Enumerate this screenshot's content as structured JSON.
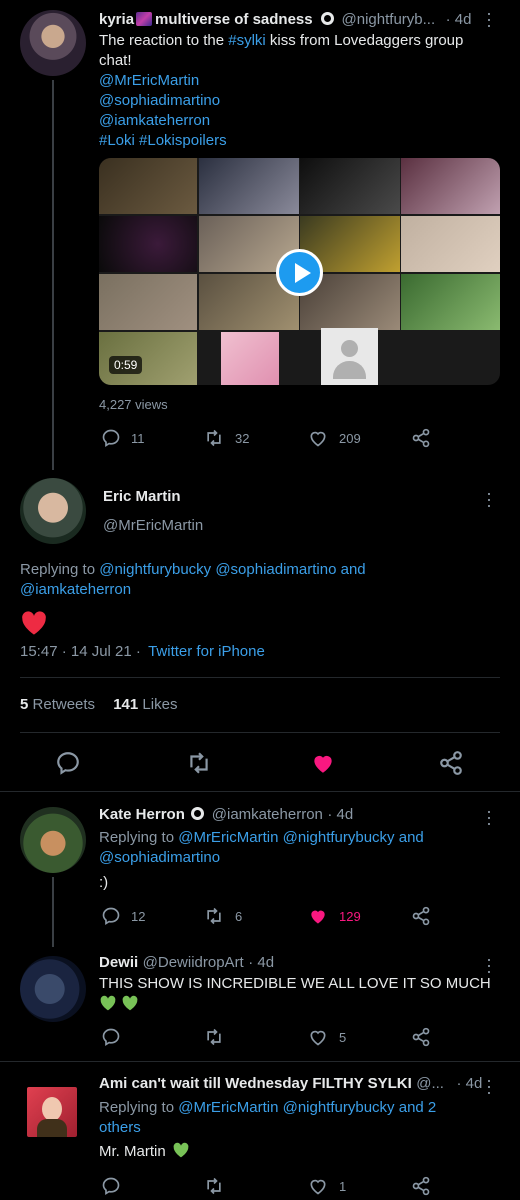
{
  "tweet1": {
    "name": "kyria",
    "name_suffix": "multiverse of sadness",
    "handle": "@nightfuryb...",
    "time": "· 4d",
    "text_prefix": "The reaction to the ",
    "hashtag": "#sylki",
    "text_suffix": " kiss from Lovedaggers group chat!",
    "mention1": "@MrEricMartin",
    "mention2": "@sophiadimartino",
    "mention3": "@iamkateherron",
    "hashtags": "#Loki #Lokispoilers",
    "video_duration": "0:59",
    "views": "4,227 views",
    "replies": "11",
    "retweets": "32",
    "likes": "209"
  },
  "main_tweet": {
    "name": "Eric Martin",
    "handle": "@MrEricMartin",
    "replying_label": "Replying to",
    "replying_to": "@nightfurybucky @sophiadimartino",
    "and": "and",
    "replying_to_2": "@iamkateherron",
    "timestamp": "15:47 · 14 Jul 21 ·",
    "source": "Twitter for iPhone",
    "retweet_count": "5",
    "retweet_label": "Retweets",
    "like_count": "141",
    "like_label": "Likes"
  },
  "reply1": {
    "name": "Kate Herron",
    "handle": "@iamkateherron",
    "time": "· 4d",
    "replying_label": "Replying to",
    "replying_to": "@MrEricMartin @nightfurybucky",
    "and": "and",
    "replying_to_2": "@sophiadimartino",
    "text": ":)",
    "replies": "12",
    "retweets": "6",
    "likes": "129"
  },
  "reply2": {
    "name": "Dewii",
    "handle": "@DewiidropArt",
    "time": "· 4d",
    "text": "THIS SHOW IS INCREDIBLE WE ALL LOVE IT SO MUCH",
    "replies": "",
    "retweets": "",
    "likes": "5"
  },
  "reply3": {
    "name": "Ami can't wait till Wednesday FILTHY SYLKI",
    "handle": "@...",
    "time": "· 4d",
    "replying_label": "Replying to",
    "replying_to": "@MrEricMartin @nightfurybucky",
    "and": "and 2",
    "others": "others",
    "text": "Mr. Martin",
    "likes": "1"
  },
  "colors": {
    "background": "#000000",
    "link": "#3b9fe8",
    "muted": "#8b98a5",
    "like_active": "#f91880",
    "green_heart": "#78c257"
  }
}
